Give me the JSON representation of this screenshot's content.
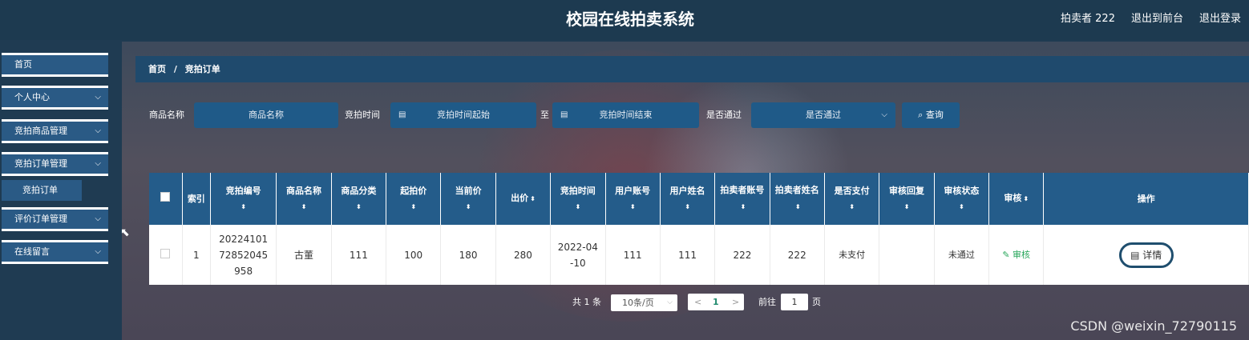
{
  "header": {
    "title": "校园在线拍卖系统",
    "user_label": "拍卖者 222",
    "to_front_label": "退出到前台",
    "logout_label": "退出登录"
  },
  "sidebar": {
    "items": [
      {
        "label": "首页"
      },
      {
        "label": "个人中心"
      },
      {
        "label": "竞拍商品管理"
      },
      {
        "label": "竞拍订单管理"
      },
      {
        "label": "评价订单管理"
      },
      {
        "label": "在线留言"
      }
    ],
    "sub_item": "竞拍订单",
    "chevron": "⌵"
  },
  "breadcrumb": {
    "home": "首页",
    "sep": "/",
    "current": "竞拍订单"
  },
  "search": {
    "goods_name_label": "商品名称",
    "goods_name_placeholder": "商品名称",
    "bid_time_label": "竞拍时间",
    "start_placeholder": "竞拍时间起始",
    "to_label": "至",
    "end_placeholder": "竞拍时间结束",
    "passed_label": "是否通过",
    "passed_placeholder": "是否通过",
    "query_label": "查询",
    "search_icon": "⌕",
    "calendar_icon": "▤"
  },
  "table": {
    "headers": [
      "索引",
      "竞拍编号",
      "商品名称",
      "商品分类",
      "起拍价",
      "当前价",
      "出价",
      "竞拍时间",
      "用户账号",
      "用户姓名",
      "拍卖者账号",
      "拍卖者姓名",
      "是否支付",
      "审核回复",
      "审核状态",
      "审核",
      "操作"
    ],
    "sort_icon": "⬍",
    "rows": [
      {
        "index": "1",
        "bid_no": "2022410172852045958",
        "bid_no_display": "20224101 72852045 958",
        "goods_name": "古董",
        "category": "111",
        "start_price": "100",
        "current_price": "180",
        "bid": "280",
        "bid_time": "2022-04 -10",
        "user_account": "111",
        "user_name": "111",
        "seller_account": "222",
        "seller_name": "222",
        "paid": "未支付",
        "audit_reply": "",
        "audit_status": "未通过",
        "audit_action": "审核",
        "detail_label": "详情"
      }
    ]
  },
  "pagination": {
    "total": "共 1 条",
    "page_size": "10条/页",
    "current_page": "1",
    "goto_label": "前往",
    "goto_value": "1",
    "page_unit": "页",
    "prev": "<",
    "next": ">"
  },
  "watermark": "CSDN @weixin_72790115"
}
